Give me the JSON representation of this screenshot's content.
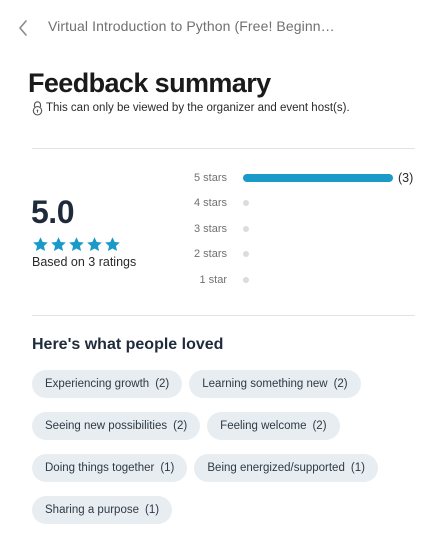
{
  "header": {
    "event_title": "Virtual Introduction to Python (Free! Beginn…"
  },
  "summary": {
    "title": "Feedback summary",
    "privacy_note": "This can only be viewed by the organizer and event host(s).",
    "score": "5.0",
    "stars_filled": 5,
    "based_on": "Based on 3 ratings",
    "accent_color": "#1a9ac9",
    "star_color": "#1a9ac9",
    "distribution": [
      {
        "label": "5 stars",
        "count": 3,
        "count_label": "(3)",
        "fraction": 1.0
      },
      {
        "label": "4 stars",
        "count": 0,
        "count_label": "",
        "fraction": 0
      },
      {
        "label": "3 stars",
        "count": 0,
        "count_label": "",
        "fraction": 0
      },
      {
        "label": "2 stars",
        "count": 0,
        "count_label": "",
        "fraction": 0
      },
      {
        "label": "1 star",
        "count": 0,
        "count_label": "",
        "fraction": 0
      }
    ]
  },
  "loved": {
    "heading": "Here's what people loved",
    "tags": [
      {
        "label": "Experiencing growth",
        "count": "(2)"
      },
      {
        "label": "Learning something new",
        "count": "(2)"
      },
      {
        "label": "Seeing new possibilities",
        "count": "(2)"
      },
      {
        "label": "Feeling welcome",
        "count": "(2)"
      },
      {
        "label": "Doing things together",
        "count": "(1)"
      },
      {
        "label": "Being energized/supported",
        "count": "(1)"
      },
      {
        "label": "Sharing a purpose",
        "count": "(1)"
      }
    ]
  }
}
